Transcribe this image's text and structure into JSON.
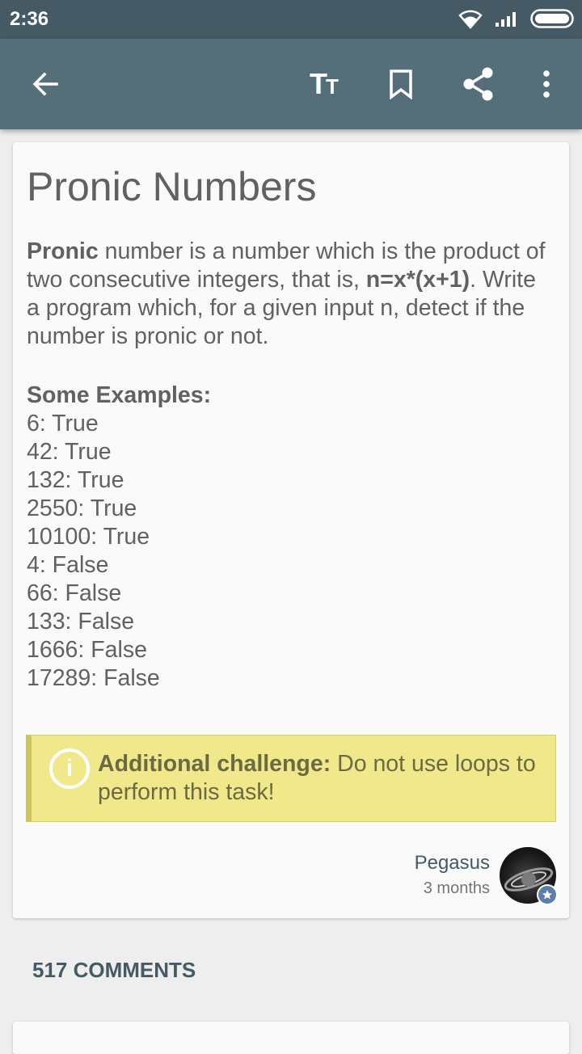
{
  "status_bar": {
    "time": "2:36"
  },
  "card": {
    "title": "Pronic Numbers",
    "intro_bold": "Pronic",
    "intro_text_1": " number is a number which is the product of two consecutive integers, that is, ",
    "formula": "n=x*(x+1)",
    "intro_text_2": ". Write a program which, for a given input n, detect if the number is pronic or not.",
    "examples_heading": "Some Examples:",
    "examples": [
      "6: True",
      "42: True",
      "132: True",
      "2550: True",
      "10100: True",
      "4: False",
      "66: False",
      "133: False",
      "1666: False",
      "17289: False"
    ],
    "callout_icon": "i",
    "callout_bold": "Additional challenge:",
    "callout_text": " Do not use loops to perform this task!",
    "author_name": "Pegasus",
    "author_time": "3 months"
  },
  "comments_label": "517 COMMENTS",
  "icons": {
    "back": "arrow-left-icon",
    "text_size": "text-size-icon",
    "bookmark": "bookmark-icon",
    "share": "share-icon",
    "more": "more-vert-icon"
  },
  "colors": {
    "status_bar": "#455a64",
    "app_bar": "#546e7a",
    "callout_bg": "#f0e88a",
    "accent_text": "#455a64"
  }
}
